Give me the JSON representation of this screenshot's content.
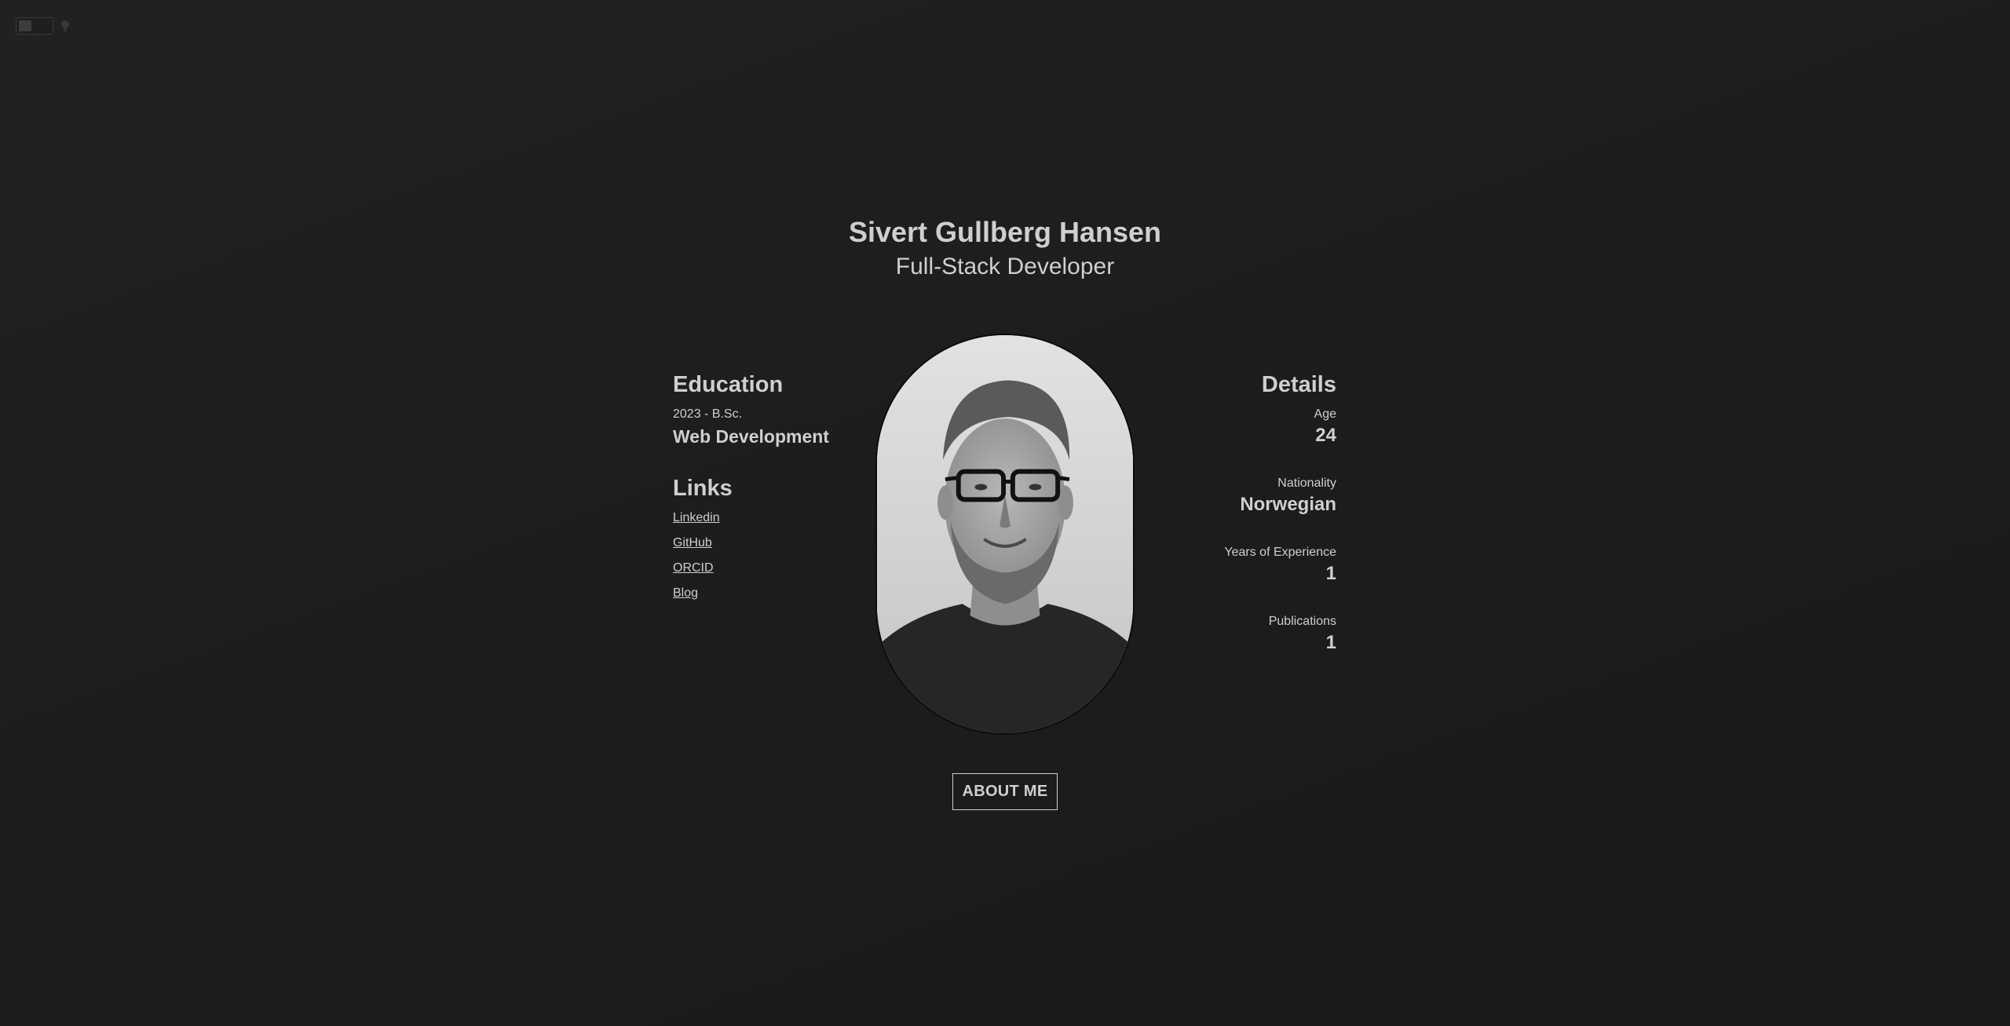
{
  "theme_toggle": {
    "icon": "lightbulb-icon"
  },
  "header": {
    "name": "Sivert Gullberg Hansen",
    "role": "Full-Stack Developer"
  },
  "education": {
    "title": "Education",
    "year": "2023 - B.Sc.",
    "degree": "Web Development"
  },
  "links": {
    "title": "Links",
    "items": [
      {
        "label": "Linkedin"
      },
      {
        "label": "GitHub"
      },
      {
        "label": "ORCID"
      },
      {
        "label": "Blog"
      }
    ]
  },
  "details": {
    "title": "Details",
    "items": [
      {
        "label": "Age",
        "value": "24"
      },
      {
        "label": "Nationality",
        "value": "Norwegian"
      },
      {
        "label": "Years of Experience",
        "value": "1"
      },
      {
        "label": "Publications",
        "value": "1"
      }
    ]
  },
  "about_button": {
    "label": "ABOUT ME"
  },
  "colors": {
    "background": "#1e1e1e",
    "text": "#cfcfcf"
  }
}
